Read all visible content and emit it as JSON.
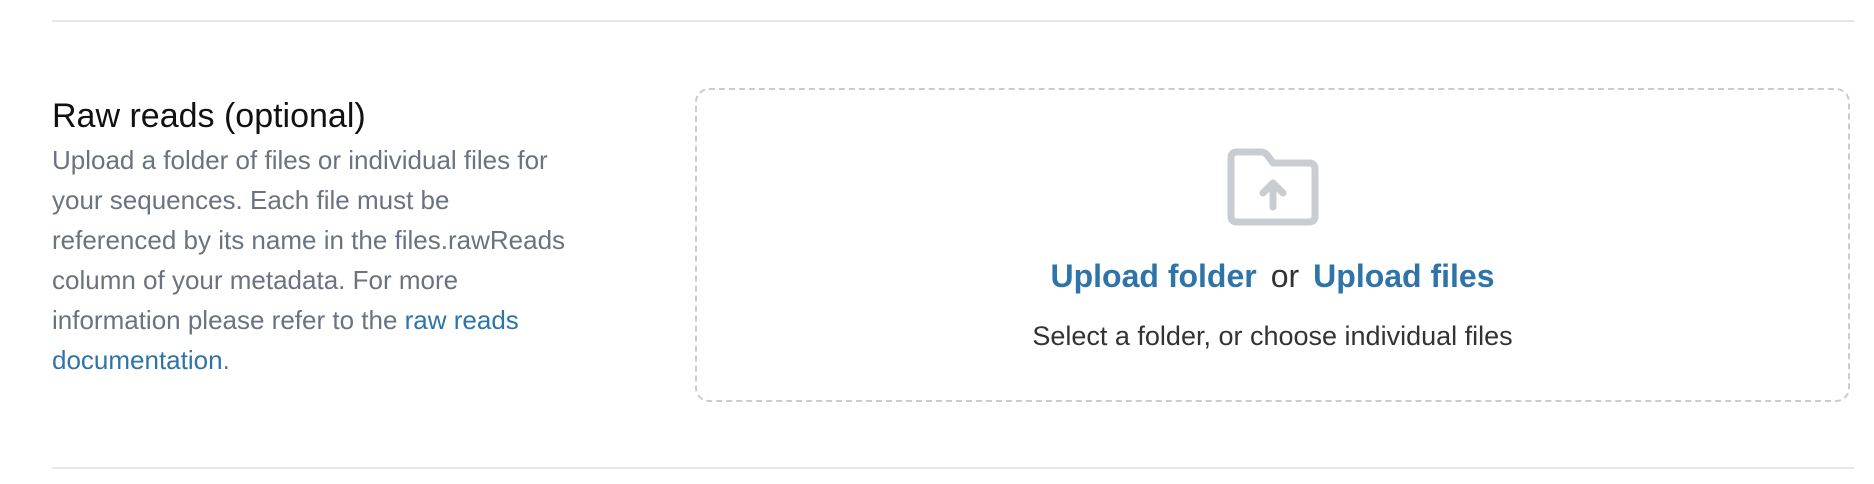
{
  "section": {
    "title": "Raw reads (optional)",
    "description_prefix": "Upload a folder of files or individual files for your sequences. Each file must be referenced by its name in the files.rawReads column of your metadata. For more information please refer to the ",
    "description_link": "raw reads documentation",
    "description_suffix": "."
  },
  "dropzone": {
    "icon": "folder-upload-icon",
    "upload_folder_label": "Upload folder",
    "or_label": "or",
    "upload_files_label": "Upload files",
    "hint": "Select a folder, or choose individual files"
  },
  "colors": {
    "link": "#2f74a8",
    "muted_text": "#6b7280",
    "icon": "#c9ccd1",
    "border": "#c9ccd1"
  }
}
